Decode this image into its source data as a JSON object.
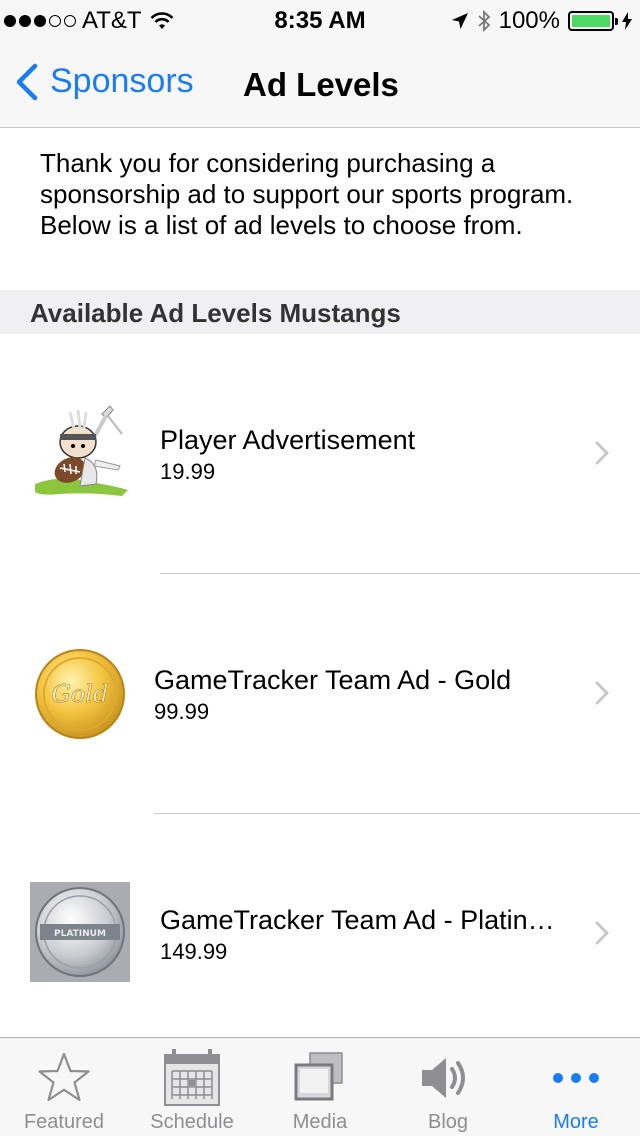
{
  "status_bar": {
    "carrier": "AT&T",
    "time": "8:35 AM",
    "battery": "100%",
    "signal_bars_filled": 3,
    "signal_bars_total": 5
  },
  "nav": {
    "back_label": "Sponsors",
    "title": "Ad Levels"
  },
  "intro_text": "Thank you for considering purchasing a sponsorship ad to support our sports program. Below is a list of ad levels to choose from.",
  "section_header": "Available Ad Levels Mustangs",
  "ad_levels": [
    {
      "title": "Player Advertisement",
      "price": "19.99",
      "icon": "mascot-football-player-image"
    },
    {
      "title": "GameTracker Team Ad - Gold",
      "price": "99.99",
      "icon": "gold-coin-image"
    },
    {
      "title": "GameTracker Team Ad - Platin…",
      "price": "149.99",
      "icon": "platinum-coin-image",
      "coin_text": "PLATINUM"
    }
  ],
  "tabs": [
    {
      "label": "Featured",
      "icon": "star-icon",
      "active": false
    },
    {
      "label": "Schedule",
      "icon": "calendar-icon",
      "active": false
    },
    {
      "label": "Media",
      "icon": "media-icon",
      "active": false
    },
    {
      "label": "Blog",
      "icon": "speaker-icon",
      "active": false
    },
    {
      "label": "More",
      "icon": "more-dots-icon",
      "active": true
    }
  ],
  "colors": {
    "accent": "#1a7cf5",
    "battery_green": "#4cd964",
    "inactive_tab": "#8e8e93",
    "section_bg": "#efeff4"
  }
}
